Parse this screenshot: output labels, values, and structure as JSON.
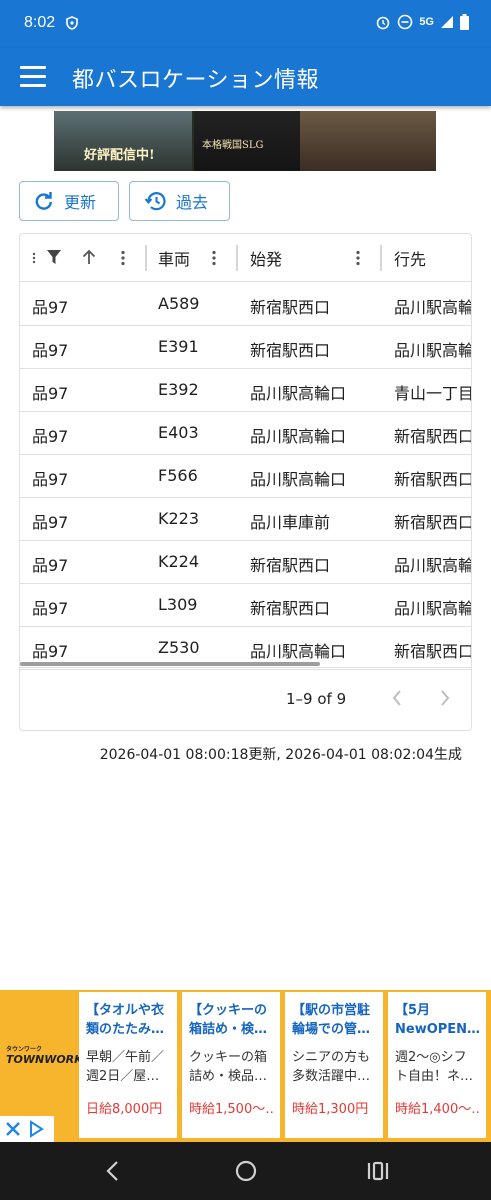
{
  "status_bar": {
    "time": "8:02",
    "network": "5G"
  },
  "app_bar": {
    "title": "都バスロケーション情報"
  },
  "toolbar": {
    "refresh_label": "更新",
    "history_label": "過去"
  },
  "grid": {
    "columns": [
      {
        "label": ""
      },
      {
        "label": "車両"
      },
      {
        "label": "始発"
      },
      {
        "label": "行先"
      }
    ],
    "rows": [
      [
        "品97",
        "A589",
        "新宿駅西口",
        "品川駅高輪"
      ],
      [
        "品97",
        "E391",
        "新宿駅西口",
        "品川駅高輪"
      ],
      [
        "品97",
        "E392",
        "品川駅高輪口",
        "青山一丁目"
      ],
      [
        "品97",
        "E403",
        "品川駅高輪口",
        "新宿駅西口"
      ],
      [
        "品97",
        "F566",
        "品川駅高輪口",
        "新宿駅西口"
      ],
      [
        "品97",
        "K223",
        "品川車庫前",
        "新宿駅西口"
      ],
      [
        "品97",
        "K224",
        "新宿駅西口",
        "品川駅高輪"
      ],
      [
        "品97",
        "L309",
        "新宿駅西口",
        "品川駅高輪"
      ],
      [
        "品97",
        "Z530",
        "品川駅高輪口",
        "新宿駅西口"
      ]
    ],
    "pagination": "1–9 of 9"
  },
  "updated_text": "2026-04-01 08:00:18更新, 2026-04-01 08:02:04生成",
  "banner_ad": {
    "text1": "好評配信中!",
    "text2": "本格戦国SLG"
  },
  "ads": {
    "logo": "TOWNWORK",
    "logo_small": "タウンワーク",
    "cards": [
      {
        "headline": "【タオルや衣類のたたみ…",
        "body": "早朝／午前／週2日／屋…",
        "wage": "日給8,000円"
      },
      {
        "headline": "【クッキーの箱詰め・検…",
        "body": "クッキーの箱詰め・検品…",
        "wage": "時給1,500～…"
      },
      {
        "headline": "【駅の市営駐輪場での管…",
        "body": "シニアの方も多数活躍中…",
        "wage": "時給1,300円"
      },
      {
        "headline": "【5月NewOPEN…",
        "body": "週2～◎シフト自由！ネ…",
        "wage": "時給1,400～…"
      }
    ]
  },
  "colors": {
    "primary": "#1976d2",
    "ad_background": "#f7b52d",
    "wage": "#e53935"
  }
}
